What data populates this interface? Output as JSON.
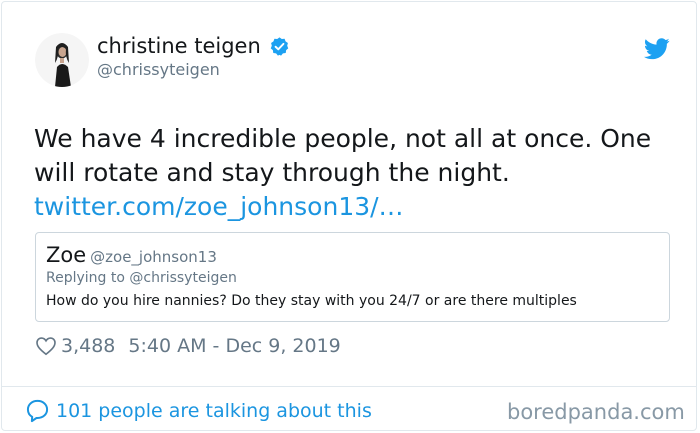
{
  "author": {
    "name": "christine teigen",
    "handle": "@chrissyteigen",
    "avatar_icon": "avatar-portrait-icon",
    "verified_icon": "verified-badge-icon",
    "verified_color": "#1da1f2"
  },
  "platform_icon": "twitter-bird-icon",
  "tweet": {
    "text": "We have 4 incredible people, not all at once. One will rotate and stay through the night.",
    "link": "twitter.com/zoe_johnson13/…"
  },
  "quoted_tweet": {
    "name": "Zoe",
    "handle": "@zoe_johnson13",
    "replying_to": "Replying to @chrissyteigen",
    "text": "How do you hire nannies? Do they stay with you 24/7 or are there multiples"
  },
  "stats": {
    "like_icon": "heart-icon",
    "likes": "3,488",
    "timestamp": "5:40 AM - Dec 9, 2019"
  },
  "footer": {
    "talk_icon": "speech-bubble-icon",
    "talking": "101 people are talking about this",
    "watermark": "boredpanda.com"
  },
  "colors": {
    "link": "#1b95e0",
    "muted": "#657786",
    "text": "#14171a",
    "border": "#e1e8ed"
  }
}
